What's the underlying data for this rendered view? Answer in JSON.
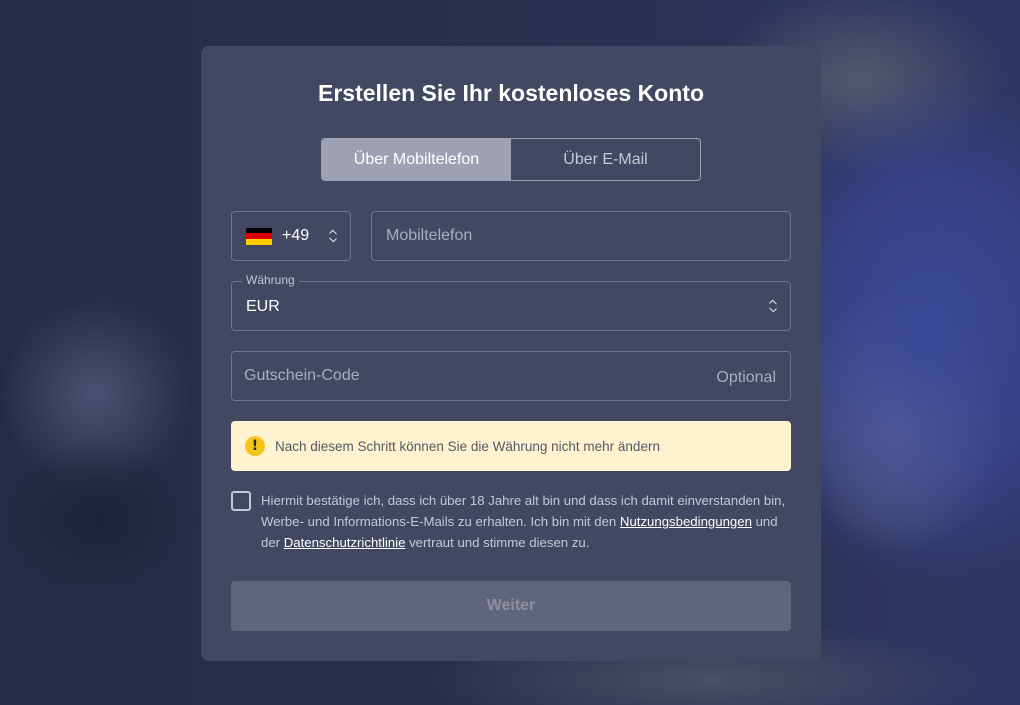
{
  "title": "Erstellen Sie Ihr kostenloses Konto",
  "tabs": [
    {
      "label": "Über Mobiltelefon",
      "active": true
    },
    {
      "label": "Über E-Mail",
      "active": false
    }
  ],
  "country": {
    "flag": "de-flag-icon",
    "code": "+49"
  },
  "phone": {
    "placeholder": "Mobiltelefon"
  },
  "currency": {
    "label": "Währung",
    "value": "EUR"
  },
  "voucher": {
    "placeholder": "Gutschein-Code",
    "optional": "Optional"
  },
  "warning": {
    "icon": "exclamation-icon",
    "text": "Nach diesem Schritt können Sie die Währung nicht mehr ändern"
  },
  "consent": {
    "part1": "Hiermit bestätige ich, dass ich über 18 Jahre alt bin und dass ich damit einverstanden bin, Werbe- und Informations-E-Mails zu erhalten. Ich bin mit den ",
    "terms_link": "Nutzungsbedingungen",
    "part2": " und der ",
    "privacy_link": "Datenschutzrichtlinie",
    "part3": " vertraut und stimme diesen zu."
  },
  "submit_label": "Weiter",
  "colors": {
    "card": "#434862",
    "tab_active": "#9da1b3",
    "warning_bg": "#fff2d0",
    "warning_icon": "#f5c518",
    "button_disabled": "#61657c"
  }
}
